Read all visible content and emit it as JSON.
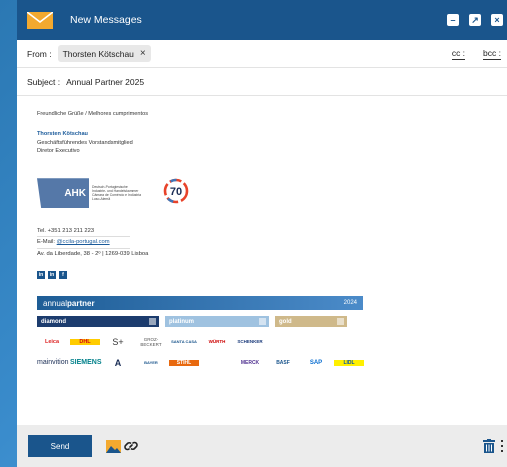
{
  "window": {
    "title": "New Messages"
  },
  "from": {
    "label": "From :",
    "recipient": "Thorsten Kötschau",
    "cc_label": "cc :",
    "bcc_label": "bcc :"
  },
  "subject": {
    "label": "Subject :",
    "value": "Annual Partner 2025"
  },
  "signature": {
    "greeting": "Freundliche Grüße / Melhores cumprimentos",
    "name": "Thorsten Kötschau",
    "role_de": "Geschäftsführendes Vorstandsmitglied",
    "role_pt": "Diretor Executivo",
    "ahk_logo": "AHK",
    "ahk_text": [
      "Deutsch-Portugiesische",
      "Industrie- und Handelskammer",
      "Câmara de Comércio e Indústria",
      "Luso-Alemã"
    ],
    "anniversary": "70",
    "phone": "Tel. +351 213 211 223",
    "email_label": "E-Mail: ",
    "email": "@ccila-portugal.com",
    "address": "Av. da Liberdade, 38 - 2º | 1269-039 Lisboa",
    "social": [
      "in",
      "in",
      "f"
    ]
  },
  "banner": {
    "title_light": "annual",
    "title_bold": "partner",
    "year": "2024",
    "tiers": [
      "diamond",
      "platinum",
      "gold"
    ],
    "logos": [
      "Leica",
      "DHL",
      "S+",
      "GROZ-BECKERT",
      "SANTA CASA",
      "WÜRTH",
      "SCHENKER",
      "",
      "",
      "",
      "mainvition",
      "SIEMENS",
      "A",
      "BAYER",
      "STIHL",
      "",
      "MERCK",
      "BASF",
      "SAP",
      "LIDL"
    ]
  },
  "footer": {
    "send_label": "Send"
  },
  "colors": {
    "brand": "#1a558c",
    "accent": "#1a5a9a"
  }
}
